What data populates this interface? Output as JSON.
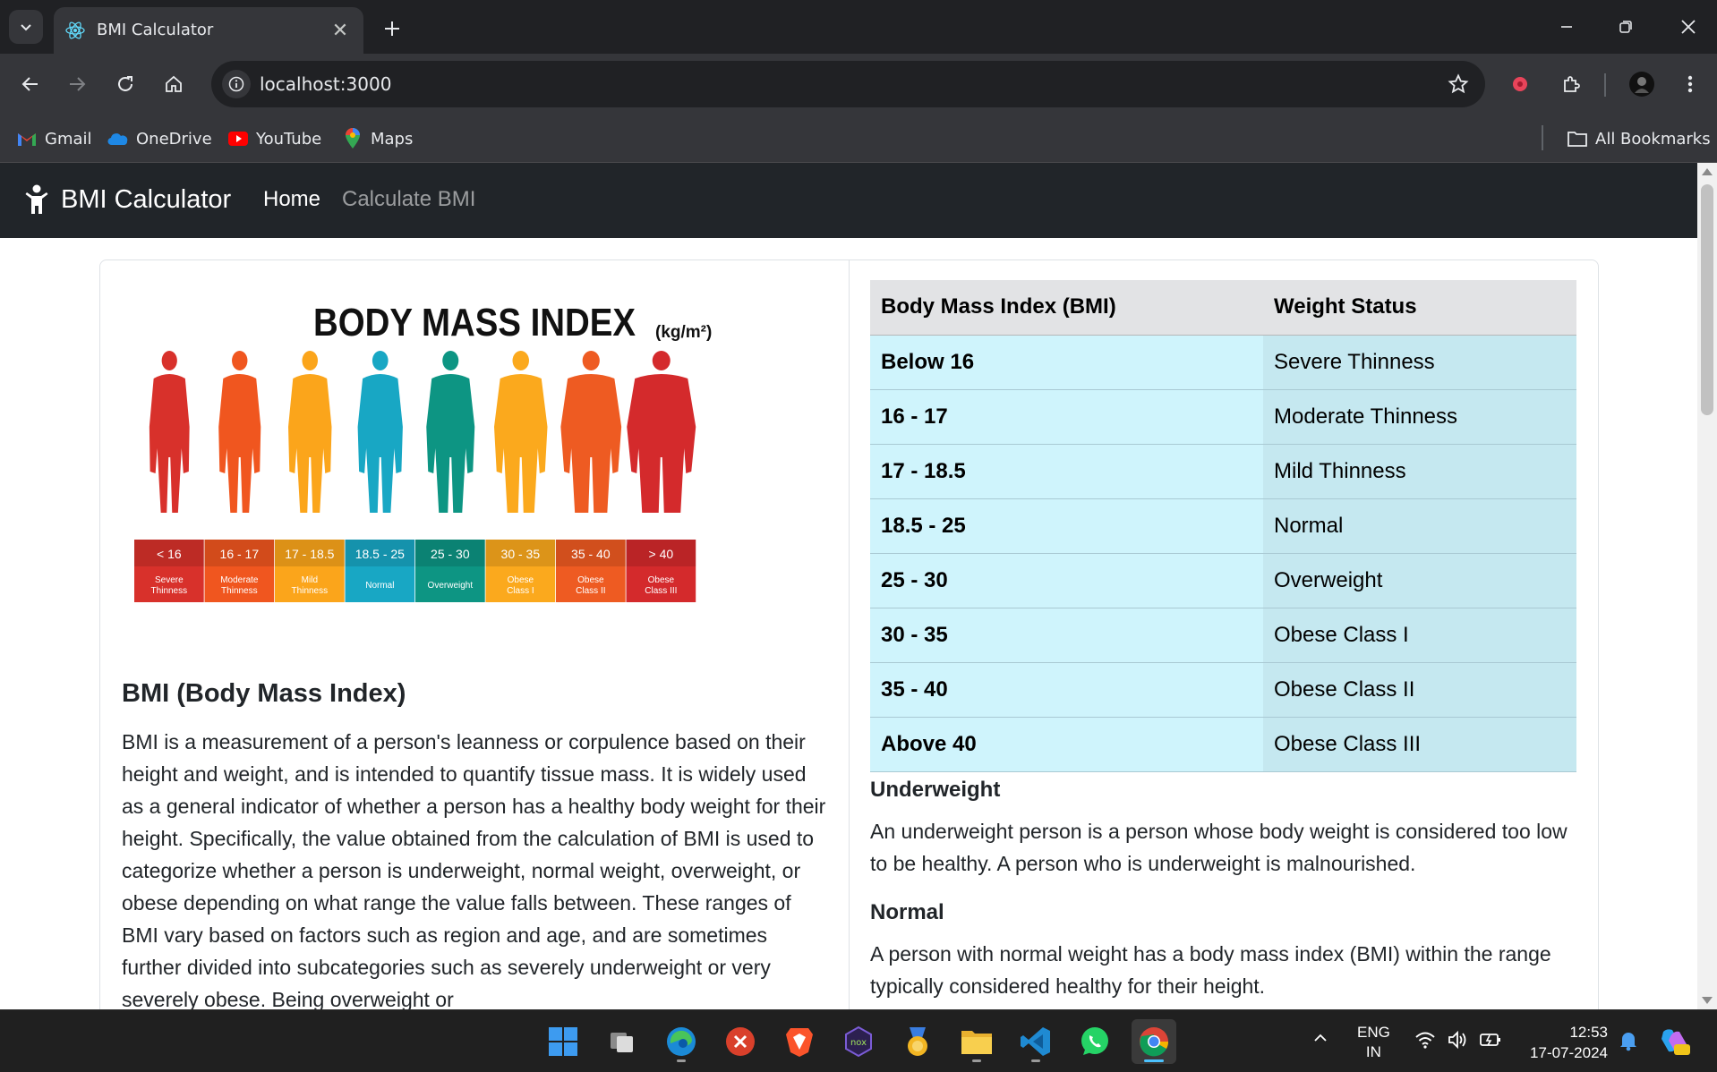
{
  "browser": {
    "tab_title": "BMI Calculator",
    "url": "localhost:3000",
    "bookmarks": [
      {
        "label": "Gmail",
        "icon": "gmail-icon"
      },
      {
        "label": "OneDrive",
        "icon": "onedrive-icon"
      },
      {
        "label": "YouTube",
        "icon": "youtube-icon"
      },
      {
        "label": "Maps",
        "icon": "maps-icon"
      }
    ],
    "all_bookmarks": "All Bookmarks"
  },
  "app": {
    "brand": "BMI Calculator",
    "nav": {
      "home": "Home",
      "calculate": "Calculate BMI"
    }
  },
  "figure": {
    "title": "BODY MASS INDEX",
    "unit": "(kg/m²)",
    "categories": [
      {
        "range": "< 16",
        "label1": "Severe",
        "label2": "Thinness",
        "color": "#d8312b"
      },
      {
        "range": "16 - 17",
        "label1": "Moderate",
        "label2": "Thinness",
        "color": "#f0561f"
      },
      {
        "range": "17 - 18.5",
        "label1": "Mild",
        "label2": "Thinness",
        "color": "#fba51b"
      },
      {
        "range": "18.5 - 25",
        "label1": "Normal",
        "label2": "",
        "color": "#18a7c4"
      },
      {
        "range": "25 - 30",
        "label1": "Overweight",
        "label2": "",
        "color": "#0d9583"
      },
      {
        "range": "30 - 35",
        "label1": "Obese",
        "label2": "Class I",
        "color": "#fba91d"
      },
      {
        "range": "35 - 40",
        "label1": "Obese",
        "label2": "Class II",
        "color": "#ee5b22"
      },
      {
        "range": "> 40",
        "label1": "Obese",
        "label2": "Class III",
        "color": "#d42a2c"
      }
    ]
  },
  "left": {
    "heading": "BMI (Body Mass Index)",
    "text": "BMI is a measurement of a person's leanness or corpulence based on their height and weight, and is intended to quantify tissue mass. It is widely used as a general indicator of whether a person has a healthy body weight for their height. Specifically, the value obtained from the calculation of BMI is used to categorize whether a person is underweight, normal weight, overweight, or obese depending on what range the value falls between. These ranges of BMI vary based on factors such as region and age, and are sometimes further divided into subcategories such as severely underweight or very severely obese. Being overweight or"
  },
  "table": {
    "headers": [
      "Body Mass Index (BMI)",
      "Weight Status"
    ],
    "rows": [
      [
        "Below 16",
        "Severe Thinness"
      ],
      [
        "16 - 17",
        "Moderate Thinness"
      ],
      [
        "17 - 18.5",
        "Mild Thinness"
      ],
      [
        "18.5 - 25",
        "Normal"
      ],
      [
        "25 - 30",
        "Overweight"
      ],
      [
        "30 - 35",
        "Obese Class I"
      ],
      [
        "35 - 40",
        "Obese Class II"
      ],
      [
        "Above 40",
        "Obese Class III"
      ]
    ]
  },
  "info": [
    {
      "heading": "Underweight",
      "text": "An underweight person is a person whose body weight is considered too low to be healthy. A person who is underweight is malnourished."
    },
    {
      "heading": "Normal",
      "text": "A person with normal weight has a body mass index (BMI) within the range typically considered healthy for their height."
    }
  ],
  "taskbar": {
    "lang1": "ENG",
    "lang2": "IN",
    "time": "12:53",
    "date": "17-07-2024"
  }
}
